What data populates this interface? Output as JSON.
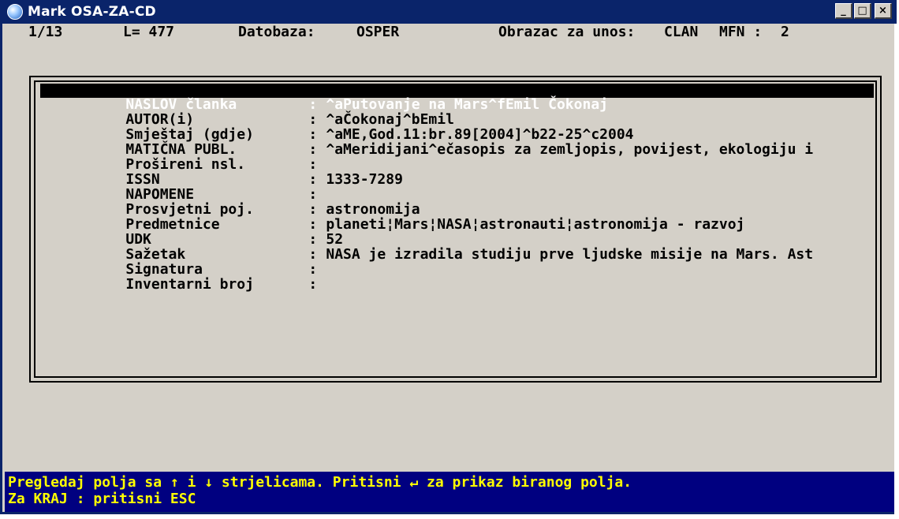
{
  "window": {
    "title": "Mark OSA-ZA-CD",
    "minimize": "_",
    "maximize": "□",
    "close": "×"
  },
  "status": {
    "record": "1/13",
    "length": "L= 477",
    "db_label": "Datobaza:",
    "db_value": "OSPER",
    "form_label": "Obrazac za unos:",
    "form_value": "CLAN",
    "mfn_label": "MFN :",
    "mfn_value": "2"
  },
  "fields": [
    {
      "label": "NASLOV članka",
      "sep": ":",
      "value": "^aPutovanje na Mars^fEmil Čokonaj"
    },
    {
      "label": "AUTOR(i)",
      "sep": ":",
      "value": "^aČokonaj^bEmil"
    },
    {
      "label": "Smještaj (gdje)",
      "sep": ":",
      "value": "^aME,God.11:br.89[2004]^b22-25^c2004"
    },
    {
      "label": "MATIČNA PUBL.",
      "sep": ":",
      "value": "^aMeridijani^ečasopis za zemljopis, povijest, ekologiju i"
    },
    {
      "label": "Prošireni nsl.",
      "sep": ":",
      "value": ""
    },
    {
      "label": "ISSN",
      "sep": ":",
      "value": "1333-7289"
    },
    {
      "label": "NAPOMENE",
      "sep": ":",
      "value": ""
    },
    {
      "label": "Prosvjetni poj.",
      "sep": ":",
      "value": "astronomija"
    },
    {
      "label": "Predmetnice",
      "sep": ":",
      "value": "planeti¦Mars¦NASA¦astronauti¦astronomija - razvoj"
    },
    {
      "label": "UDK",
      "sep": ":",
      "value": "52"
    },
    {
      "label": "Sažetak",
      "sep": ":",
      "value": "NASA je izradila studiju prve ljudske misije na Mars. Ast"
    },
    {
      "label": "Signatura",
      "sep": ":",
      "value": ""
    },
    {
      "label": "Inventarni broj",
      "sep": ":",
      "value": ""
    }
  ],
  "footer": {
    "line1": "Pregledaj polja sa ↑ i ↓ strjelicama. Pritisni ↵ za prikaz biranog polja.",
    "line2": "Za KRAJ : pritisni ESC"
  },
  "colors": {
    "titlebar": "#0a246a",
    "console_bg": "#d4d0c8",
    "footer_bg": "#000080",
    "footer_text": "#ffff00",
    "selection_bg": "#000000"
  },
  "icons": {
    "app": "app-icon",
    "minimize": "minimize-icon",
    "maximize": "maximize-icon",
    "close": "close-icon"
  }
}
